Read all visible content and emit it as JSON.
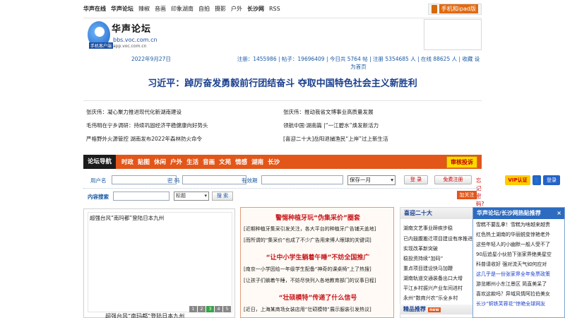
{
  "topnav": {
    "items": [
      "华声在线",
      "华声论坛",
      "辣椒",
      "音画",
      "印象湖南",
      "自拍",
      "摄影",
      "户外",
      "长沙网",
      "RSS"
    ],
    "mobile_label": "手机和ipad版"
  },
  "logo": {
    "name": "华声论坛",
    "url1": "bbs.voc.com.cn",
    "url2": "app.voc.com.cn",
    "tag": "手机客户端"
  },
  "stats": {
    "date": "2022年9月27日",
    "text": "注册：1455986 | 帖子：19696409 | 今日共 5764 帖 | 注册 5354685 人 | 在线 88625 人 | 收藏 设为首页"
  },
  "headline": "习近平：踔厉奋发勇毅前行团结奋斗 夺取中国特色社会主义新胜利",
  "news": {
    "left": [
      "张庆伟：凝心聚力推进现代化新湖南建设",
      "毛伟明在宁乡调研：持续巩固经济平稳健康向好势头",
      "严格野外火源管控 湖南发布2022年森林防火命令"
    ],
    "right": [
      "张庆伟：推动我省文博事业高质量发展",
      "领航中国·湖南篇 |“一江碧水”焕发新活力",
      "[喜迎二十大]岳阳退捕渔民“上岸”过上新生活"
    ]
  },
  "forum_nav": {
    "title": "论坛导航",
    "items": [
      "时政",
      "贴图",
      "休闲",
      "户外",
      "生活",
      "音画",
      "文苑",
      "情感",
      "湖南",
      "长沙"
    ],
    "complain": "审核投诉"
  },
  "login": {
    "user_label": "用户名",
    "pass_label": "密 码",
    "validity_label": "有效期",
    "validity_value": "保存一月",
    "login_btn": "登 录",
    "register_btn": "免费注册",
    "forgot": "忘记密码?",
    "vip": "VIP认证",
    "login2": "登录"
  },
  "search": {
    "label": "内容搜索",
    "scope": "标题",
    "button": "搜 索",
    "follow": "加关注"
  },
  "left_feature": {
    "title": "超强台风“南玛都”登陆日本九州",
    "pages": [
      "1",
      "2",
      "3",
      "4",
      "5"
    ],
    "active_page": "3",
    "caption": "超强台风“南玛都”登陆日本九州"
  },
  "middle": {
    "blocks": [
      {
        "heading": "警惕种植牙玩“伪集采价”圈套",
        "lines": [
          "[近期种植牙集采引发关注，各大平台的种植牙广告铺天盖地]",
          "[而所谓的“集采价”也成了不少广告用来博人眼球的关键词]"
        ]
      },
      {
        "heading": "“让中小学生躺着午睡”不妨全国推广",
        "lines": [
          "[南京一小学因给一年级学生配备“神奇的课桌椅”上了热搜]",
          "[让孩子们躺着午睡，不妨尽快列入各地教育部门的议事日程]"
        ]
      },
      {
        "heading": "“壮硕模特”传递了什么信号",
        "lines": [
          "[近日，上海某商场女装店用“壮硕模特”展示服装引发热议]",
          "[对这一现象有人点赞，有人觉得不妥]"
        ]
      }
    ]
  },
  "right": {
    "heading": "喜迎二十大",
    "items": [
      "湖南文艺事业蹄疾步稳",
      "已内鼓腹搬迁项目建设有序推进",
      "实现改革新突破",
      "稳投资持续“加码”",
      "重点项目建设快马加鞭",
      "湖南轨道交通装备出口大增",
      "平江乡村振兴产业车间进村",
      "永州“数商兴农”乐全乡村"
    ],
    "rec_heading": "精品推荐",
    "rec_badge": "new"
  },
  "popup": {
    "title": "华声论坛/长沙网热贴推荐",
    "close": "×",
    "items": [
      "雪糕不要乱拿！雪糕为啥越来越贵",
      "红色热土湖南的华丽蜕变惊艳老外",
      "这些年轻人的小幽默一般人受不了",
      "90后追星小伙拍下张家界绝美星空",
      "科普请收好 强对流天气如何应对",
      "这几乎是一份张家界全年免票政策",
      "游览郴州小东江景区 简直美呆了",
      "喜欢这款吗？异域风情阿拉伯美女",
      "长沙“铜铁芙蓉花”惊艳全球网友"
    ],
    "blue_rows": [
      5,
      6,
      8
    ]
  }
}
